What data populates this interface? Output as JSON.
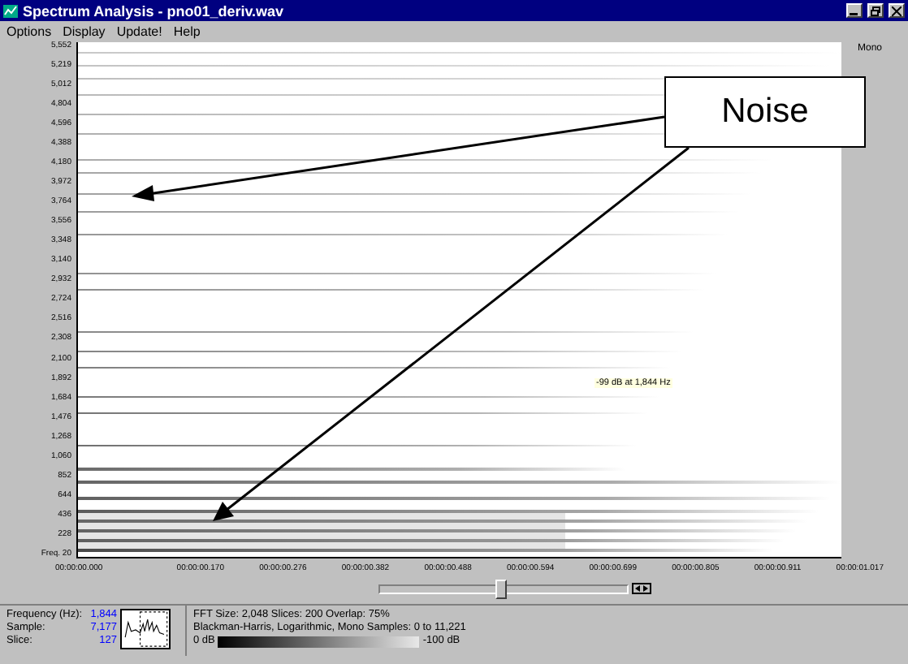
{
  "window": {
    "title": "Spectrum Analysis - pno01_deriv.wav"
  },
  "menu": [
    {
      "label": "Options"
    },
    {
      "label": "Display"
    },
    {
      "label": "Update!"
    },
    {
      "label": "Help"
    }
  ],
  "channel_label": "Mono",
  "y_axis": {
    "labels": [
      "5,552",
      "5,219",
      "5,012",
      "4,804",
      "4,596",
      "4,388",
      "4,180",
      "3,972",
      "3,764",
      "3,556",
      "3,348",
      "3,140",
      "2,932",
      "2,724",
      "2,516",
      "2,308",
      "2,100",
      "1,892",
      "1,684",
      "1,476",
      "1,268",
      "1,060",
      "852",
      "644",
      "436",
      "228",
      "Freq. 20"
    ]
  },
  "x_axis": {
    "labels": [
      "00:00:00.000",
      "00:00:00.170",
      "00:00:00.276",
      "00:00:00.382",
      "00:00:00.488",
      "00:00:00.594",
      "00:00:00.699",
      "00:00:00.805",
      "00:00:00.911",
      "00:00:01.017"
    ]
  },
  "tooltip": "-99 dB at 1,844 Hz",
  "callout": {
    "text": "Noise"
  },
  "slider": {
    "level": 0.49
  },
  "info": [
    {
      "label": "Frequency (Hz):",
      "value": "1,844"
    },
    {
      "label": "Sample:",
      "value": "7,177"
    },
    {
      "label": "Slice:",
      "value": "127"
    }
  ],
  "fft": {
    "lines": [
      "FFT Size: 2,048  Slices: 200  Overlap: 75%",
      "Blackman-Harris, Logarithmic, Mono  Samples: 0 to 11,221"
    ],
    "scale_min": "0 dB",
    "scale_max": "-100 dB"
  }
}
